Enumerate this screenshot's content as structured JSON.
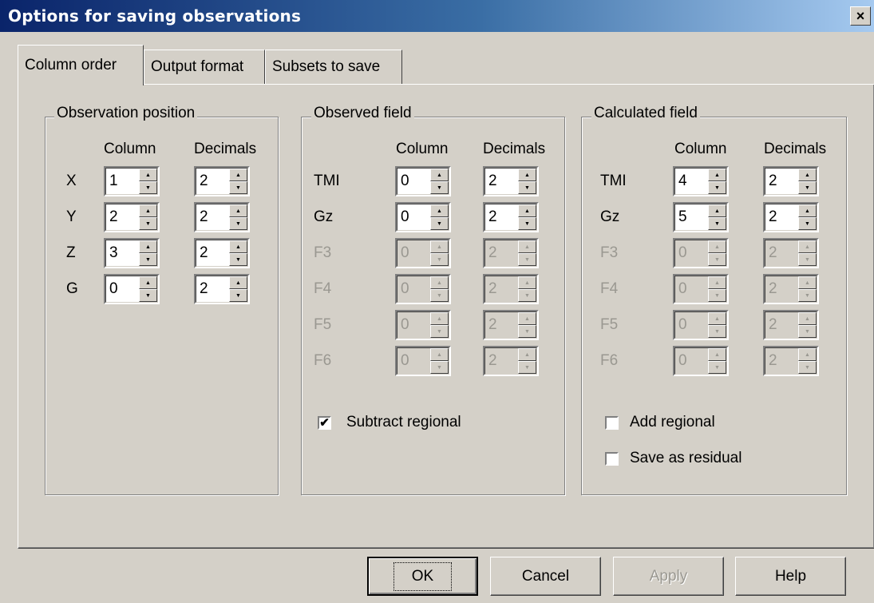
{
  "window": {
    "title": "Options for saving observations",
    "close": "×"
  },
  "tabs": [
    {
      "label": "Column order"
    },
    {
      "label": "Output format"
    },
    {
      "label": "Subsets to save"
    }
  ],
  "groups": {
    "observation_position": {
      "title": "Observation position",
      "col_header": "Column",
      "dec_header": "Decimals",
      "rows": [
        {
          "label": "X",
          "column": "1",
          "decimals": "2"
        },
        {
          "label": "Y",
          "column": "2",
          "decimals": "2"
        },
        {
          "label": "Z",
          "column": "3",
          "decimals": "2"
        },
        {
          "label": "G",
          "column": "0",
          "decimals": "2"
        }
      ]
    },
    "observed_field": {
      "title": "Observed field",
      "col_header": "Column",
      "dec_header": "Decimals",
      "rows": [
        {
          "label": "TMI",
          "column": "0",
          "decimals": "2"
        },
        {
          "label": "Gz",
          "column": "0",
          "decimals": "2"
        },
        {
          "label": "F3",
          "column": "0",
          "decimals": "2"
        },
        {
          "label": "F4",
          "column": "0",
          "decimals": "2"
        },
        {
          "label": "F5",
          "column": "0",
          "decimals": "2"
        },
        {
          "label": "F6",
          "column": "0",
          "decimals": "2"
        }
      ],
      "checkboxes": [
        {
          "label": "Subtract regional",
          "checked": true
        }
      ]
    },
    "calculated_field": {
      "title": "Calculated field",
      "col_header": "Column",
      "dec_header": "Decimals",
      "rows": [
        {
          "label": "TMI",
          "column": "4",
          "decimals": "2"
        },
        {
          "label": "Gz",
          "column": "5",
          "decimals": "2"
        },
        {
          "label": "F3",
          "column": "0",
          "decimals": "2"
        },
        {
          "label": "F4",
          "column": "0",
          "decimals": "2"
        },
        {
          "label": "F5",
          "column": "0",
          "decimals": "2"
        },
        {
          "label": "F6",
          "column": "0",
          "decimals": "2"
        }
      ],
      "checkboxes": [
        {
          "label": "Add regional",
          "checked": false
        },
        {
          "label": "Save as residual",
          "checked": false
        }
      ]
    }
  },
  "buttons": {
    "ok": "OK",
    "cancel": "Cancel",
    "apply": "Apply",
    "help": "Help"
  },
  "colors": {
    "titlebar_start": "#0a246a",
    "titlebar_end": "#a6caf0",
    "face": "#d4d0c8",
    "disabled_text": "#9a9891"
  }
}
